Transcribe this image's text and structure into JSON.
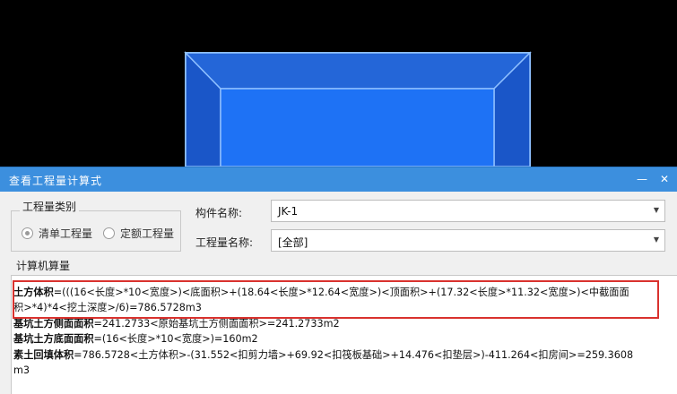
{
  "dialog": {
    "title": "查看工程量计算式",
    "min_icon": "minimize-icon",
    "close_icon": "close-icon"
  },
  "quantity_type": {
    "legend": "工程量类别",
    "options": [
      {
        "label": "清单工程量",
        "selected": true
      },
      {
        "label": "定额工程量",
        "selected": false
      }
    ]
  },
  "component": {
    "label": "构件名称:",
    "value": "JK-1"
  },
  "quantity_name": {
    "label": "工程量名称:",
    "value": "[全部]"
  },
  "calc": {
    "label": "计算机算量",
    "lines": [
      {
        "name": "土方体积",
        "expr": "=(((16<长度>*10<宽度>)<底面积>+(18.64<长度>*12.64<宽度>)<顶面积>+(17.32<长度>*11.32<宽度>)<中截面面"
      },
      {
        "name": "",
        "expr": "积>*4)*4<挖土深度>/6)=786.5728m3"
      },
      {
        "name": "基坑土方侧面面积",
        "expr": "=241.2733<原始基坑土方侧面面积>=241.2733m2"
      },
      {
        "name": "基坑土方底面面积",
        "expr": "=(16<长度>*10<宽度>)=160m2"
      },
      {
        "name": "素土回填体积",
        "expr": "=786.5728<土方体积>-(31.552<扣剪力墙>+69.92<扣筏板基础>+14.476<扣垫层>)-411.264<扣房间>=259.3608"
      },
      {
        "name": "",
        "expr": "m3"
      }
    ]
  },
  "colors": {
    "titlebar": "#3c8fde",
    "highlight": "#d9322e",
    "model_fill": "#1e6ff0",
    "model_edge": "#7ab4ff"
  }
}
